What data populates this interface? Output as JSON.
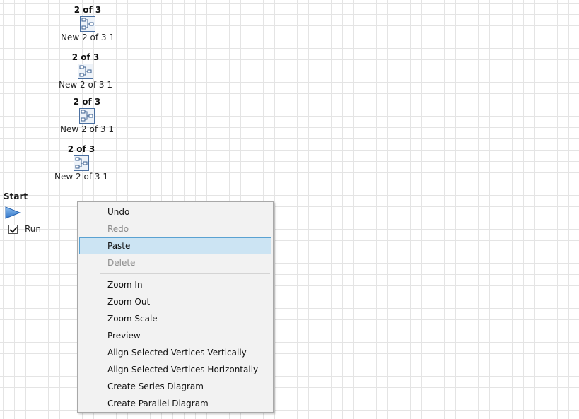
{
  "vertices": [
    {
      "title": "2 of 3",
      "label": "New 2 of 3 1"
    },
    {
      "title": "2 of 3",
      "label": "New 2 of 3 1"
    },
    {
      "title": "2 of 3",
      "label": "New 2 of 3 1"
    },
    {
      "title": "2 of 3",
      "label": "New 2 of 3 1"
    }
  ],
  "start": {
    "title": "Start",
    "run_label": "Run",
    "run_checked": true
  },
  "context_menu": {
    "items": [
      {
        "label": "Undo",
        "enabled": true
      },
      {
        "label": "Redo",
        "enabled": false
      },
      {
        "label": "Paste",
        "enabled": true,
        "highlighted": true
      },
      {
        "label": "Delete",
        "enabled": false
      },
      {
        "label": "Zoom In",
        "enabled": true
      },
      {
        "label": "Zoom Out",
        "enabled": true
      },
      {
        "label": "Zoom Scale",
        "enabled": true
      },
      {
        "label": "Preview",
        "enabled": true
      },
      {
        "label": "Align Selected Vertices Vertically",
        "enabled": true
      },
      {
        "label": "Align Selected Vertices Horizontally",
        "enabled": true
      },
      {
        "label": "Create Series Diagram",
        "enabled": true
      },
      {
        "label": "Create Parallel Diagram",
        "enabled": true
      }
    ]
  },
  "colors": {
    "menu_highlight": "#cce4f3",
    "menu_highlight_border": "#5aa2d2",
    "play_icon": "#4a8fd6",
    "grid_line": "#e4e4e4"
  },
  "icons": {
    "vertex": "diagram-node-icon",
    "start": "play-icon"
  }
}
